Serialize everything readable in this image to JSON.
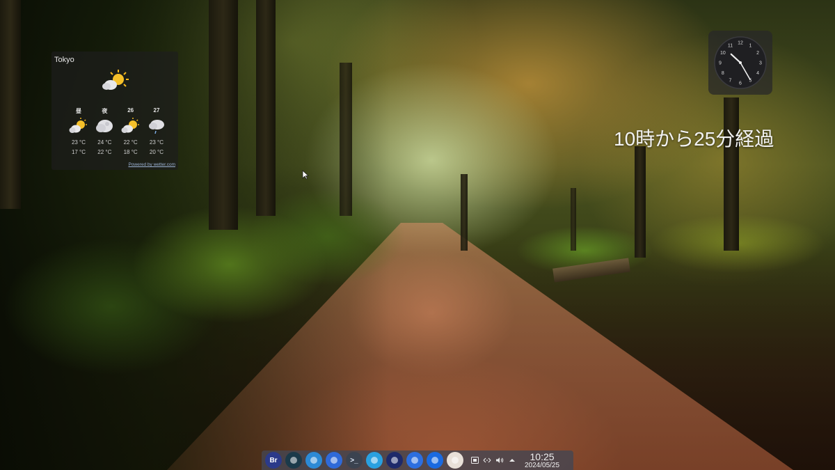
{
  "weather": {
    "city": "Tokyo",
    "main_icon": "partly-sunny-icon",
    "forecast": [
      {
        "label": "昼",
        "icon": "partly-sunny-icon",
        "high": "23 °C",
        "low": "17 °C"
      },
      {
        "label": "夜",
        "icon": "cloudy-moon-icon",
        "high": "24 °C",
        "low": "22 °C"
      },
      {
        "label": "26",
        "icon": "partly-sunny-icon",
        "high": "22 °C",
        "low": "18 °C"
      },
      {
        "label": "27",
        "icon": "light-rain-icon",
        "high": "23 °C",
        "low": "20 °C"
      }
    ],
    "powered_by": "Powered by wetter.com"
  },
  "analog_clock": {
    "hour": 10,
    "minute": 25,
    "numerals": [
      "12",
      "1",
      "2",
      "3",
      "4",
      "5",
      "6",
      "7",
      "8",
      "9",
      "10",
      "11"
    ]
  },
  "fuzzy_clock": {
    "text": "10時から25分経過"
  },
  "dock": {
    "apps": [
      {
        "name": "bridge-app-icon",
        "text": "Br",
        "color": "#2b3a8a"
      },
      {
        "name": "network-app-icon",
        "text": "",
        "color": "#1b3a4a"
      },
      {
        "name": "browser-app-icon",
        "text": "",
        "color": "#2c8ad6"
      },
      {
        "name": "blue-app-icon",
        "text": "",
        "color": "#2f6ad8"
      },
      {
        "name": "terminal-icon",
        "text": ">_",
        "color": "#3b4350"
      },
      {
        "name": "tool-app-icon",
        "text": "",
        "color": "#2aa0e0"
      },
      {
        "name": "system-monitor-icon",
        "text": "",
        "color": "#1e2a6a"
      },
      {
        "name": "messaging-app-icon",
        "text": "",
        "color": "#2d6fe0"
      },
      {
        "name": "night-mode-app-icon",
        "text": "",
        "color": "#1a6ae0"
      },
      {
        "name": "avatar-app-icon",
        "text": "",
        "color": "#e8e0d8"
      }
    ],
    "tray": [
      "keyboard-icon",
      "network-icon",
      "volume-icon",
      "up-arrow-icon"
    ],
    "time": "10:25",
    "date": "2024/05/25"
  },
  "colors": {
    "widget_bg": "#1e1e1e",
    "dock_bg": "#464650",
    "text": "#f2f2f2"
  }
}
